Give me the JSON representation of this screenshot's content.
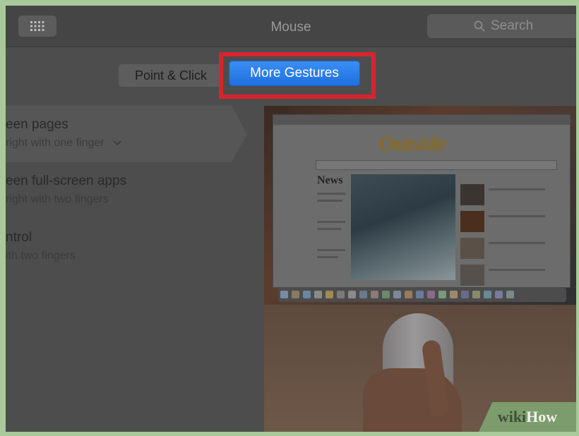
{
  "window": {
    "title": "Mouse"
  },
  "search": {
    "placeholder": "Search"
  },
  "tabs": [
    {
      "label": "Point & Click",
      "selected": false
    },
    {
      "label": "More Gestures",
      "selected": true
    }
  ],
  "options": [
    {
      "title": "een pages",
      "subtitle": "right with one finger"
    },
    {
      "title": "een full-screen apps",
      "subtitle": "right with two fingers"
    },
    {
      "title": "ntrol",
      "subtitle": "ith two fingers"
    }
  ],
  "preview": {
    "site_logo": "Outside",
    "section": "News"
  },
  "watermark": {
    "prefix": "wiki",
    "suffix": "How"
  },
  "colors": {
    "accent": "#2a7fee",
    "highlight_box": "#d8242e",
    "background": "#a9c99a"
  },
  "icons": [
    "grid-icon",
    "search-icon",
    "chevron-down-icon"
  ]
}
